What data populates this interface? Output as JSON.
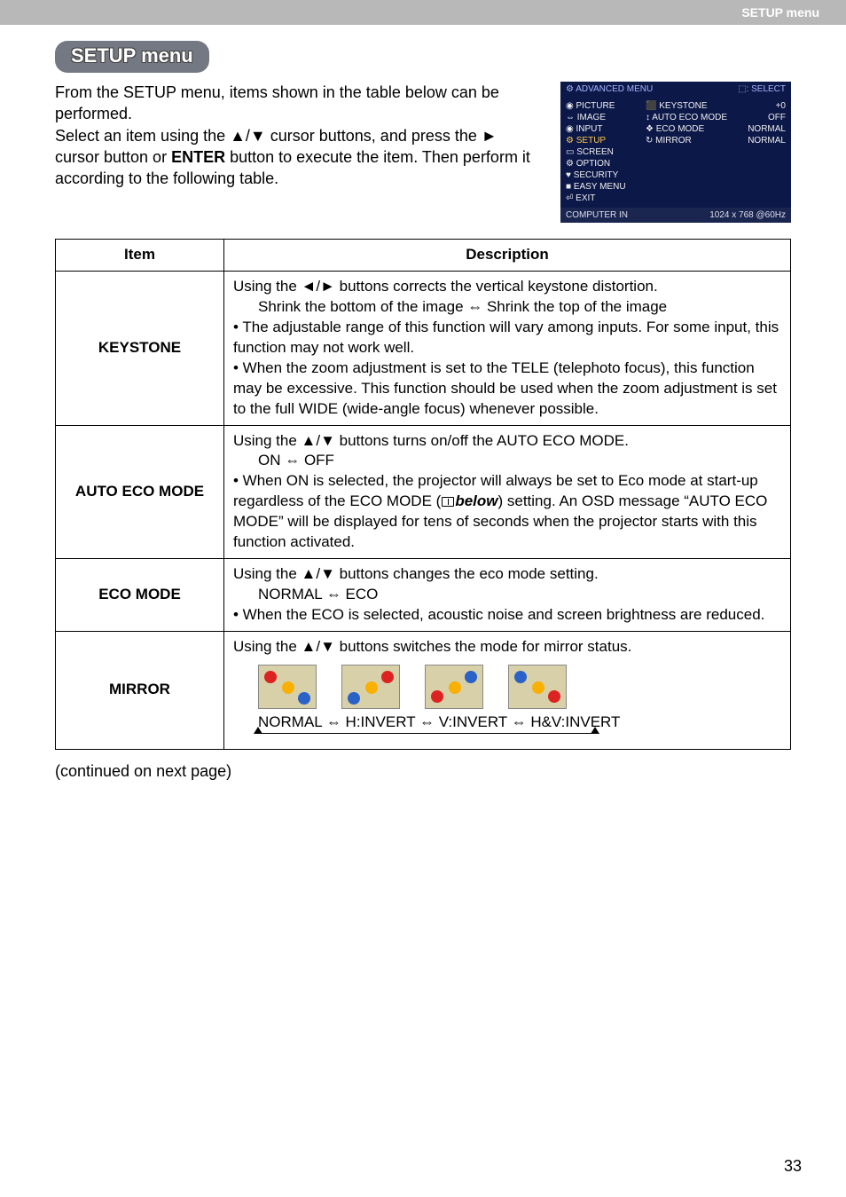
{
  "header": {
    "right_label": "SETUP menu"
  },
  "title": "SETUP menu",
  "intro": "From the SETUP menu, items shown in the table below can be performed.\nSelect an item using the ▲/▼ cursor buttons, and press the ► cursor button or ENTER button to execute the item. Then perform it according to the following table.",
  "screenshot": {
    "top_left": "⚙ ADVANCED MENU",
    "top_right": "⬚: SELECT",
    "left_items": [
      "◉ PICTURE",
      "⇔ IMAGE",
      "◉ INPUT",
      "⚙ SETUP",
      "▭ SCREEN",
      "⚙ OPTION",
      "♥ SECURITY",
      "■ EASY MENU",
      "⏎ EXIT"
    ],
    "selected_index": 3,
    "right_rows": [
      {
        "l": "⬛ KEYSTONE",
        "r": "+0"
      },
      {
        "l": "↕ AUTO ECO MODE",
        "r": "OFF"
      },
      {
        "l": "❖ ECO MODE",
        "r": "NORMAL"
      },
      {
        "l": "↻ MIRROR",
        "r": "NORMAL"
      }
    ],
    "bottom_left": "COMPUTER IN",
    "bottom_right": "1024 x 768 @60Hz"
  },
  "table": {
    "head_item": "Item",
    "head_desc": "Description",
    "rows": [
      {
        "item": "KEYSTONE",
        "desc_line1": "Using the ◄/► buttons corrects the vertical keystone distortion.",
        "desc_line2": "Shrink the bottom of the image ⇔ Shrink the top of the image",
        "desc_bullets": "• The adjustable range of this function will vary among inputs. For some input, this function may not work well.\n• When the zoom adjustment is set to the TELE (telephoto focus), this function may be excessive. This function should be used when the zoom adjustment is set to the full WIDE (wide-angle focus) whenever possible."
      },
      {
        "item": "AUTO ECO MODE",
        "desc_line1": "Using the ▲/▼ buttons turns on/off the AUTO ECO MODE.",
        "desc_line2": "ON ⇔ OFF",
        "desc_bullets_pre": "• When ON is selected, the projector will always be set to Eco mode at start-up regardless of the ECO MODE (",
        "desc_bullets_mid": "below",
        "desc_bullets_post": ") setting. An OSD message “AUTO ECO MODE” will be displayed for tens of seconds when the projector starts with this function activated."
      },
      {
        "item": "ECO MODE",
        "desc_line1": "Using the ▲/▼ buttons changes the eco mode setting.",
        "desc_line2": "NORMAL ⇔ ECO",
        "desc_bullets": "• When the ECO is selected, acoustic noise and screen brightness are reduced."
      },
      {
        "item": "MIRROR",
        "desc_line1": "Using the ▲/▼ buttons switches the mode for mirror status.",
        "options": "NORMAL ⇔ H:INVERT ⇔ V:INVERT ⇔ H&V:INVERT"
      }
    ]
  },
  "continued": "(continued on next page)",
  "page_number": "33"
}
